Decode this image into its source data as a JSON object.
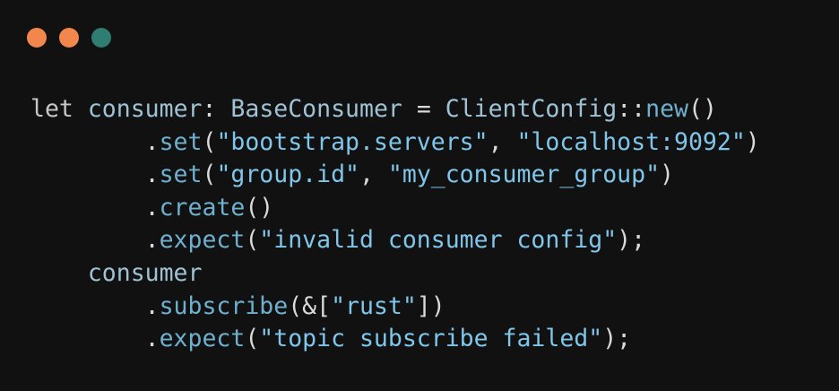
{
  "window": {
    "controls": [
      {
        "name": "close",
        "color": "#f2874d"
      },
      {
        "name": "minimize",
        "color": "#f2874d"
      },
      {
        "name": "maximize",
        "color": "#2f7d73"
      }
    ]
  },
  "code": {
    "lines": [
      [
        {
          "t": "let",
          "c": "kw"
        },
        {
          "t": " ",
          "c": "pu"
        },
        {
          "t": "consumer",
          "c": "tx"
        },
        {
          "t": ": ",
          "c": "pu"
        },
        {
          "t": "BaseConsumer",
          "c": "tx"
        },
        {
          "t": " = ",
          "c": "pu"
        },
        {
          "t": "ClientConfig",
          "c": "tx"
        },
        {
          "t": "::",
          "c": "pu"
        },
        {
          "t": "new",
          "c": "fn"
        },
        {
          "t": "()",
          "c": "pu"
        }
      ],
      [
        {
          "t": "        .",
          "c": "pu"
        },
        {
          "t": "set",
          "c": "fn"
        },
        {
          "t": "(",
          "c": "pu"
        },
        {
          "t": "\"bootstrap.servers\"",
          "c": "str"
        },
        {
          "t": ", ",
          "c": "pu"
        },
        {
          "t": "\"localhost:9092\"",
          "c": "str"
        },
        {
          "t": ")",
          "c": "pu"
        }
      ],
      [
        {
          "t": "        .",
          "c": "pu"
        },
        {
          "t": "set",
          "c": "fn"
        },
        {
          "t": "(",
          "c": "pu"
        },
        {
          "t": "\"group.id\"",
          "c": "str"
        },
        {
          "t": ", ",
          "c": "pu"
        },
        {
          "t": "\"my_consumer_group\"",
          "c": "str"
        },
        {
          "t": ")",
          "c": "pu"
        }
      ],
      [
        {
          "t": "        .",
          "c": "pu"
        },
        {
          "t": "create",
          "c": "fn"
        },
        {
          "t": "()",
          "c": "pu"
        }
      ],
      [
        {
          "t": "        .",
          "c": "pu"
        },
        {
          "t": "expect",
          "c": "fn"
        },
        {
          "t": "(",
          "c": "pu"
        },
        {
          "t": "\"invalid consumer config\"",
          "c": "str"
        },
        {
          "t": ");",
          "c": "pu"
        }
      ],
      [
        {
          "t": "    ",
          "c": "pu"
        },
        {
          "t": "consumer",
          "c": "tx"
        }
      ],
      [
        {
          "t": "        .",
          "c": "pu"
        },
        {
          "t": "subscribe",
          "c": "fn"
        },
        {
          "t": "(&[",
          "c": "pu"
        },
        {
          "t": "\"rust\"",
          "c": "str"
        },
        {
          "t": "])",
          "c": "pu"
        }
      ],
      [
        {
          "t": "        .",
          "c": "pu"
        },
        {
          "t": "expect",
          "c": "fn"
        },
        {
          "t": "(",
          "c": "pu"
        },
        {
          "t": "\"topic subscribe failed\"",
          "c": "str"
        },
        {
          "t": ");",
          "c": "pu"
        }
      ]
    ]
  }
}
